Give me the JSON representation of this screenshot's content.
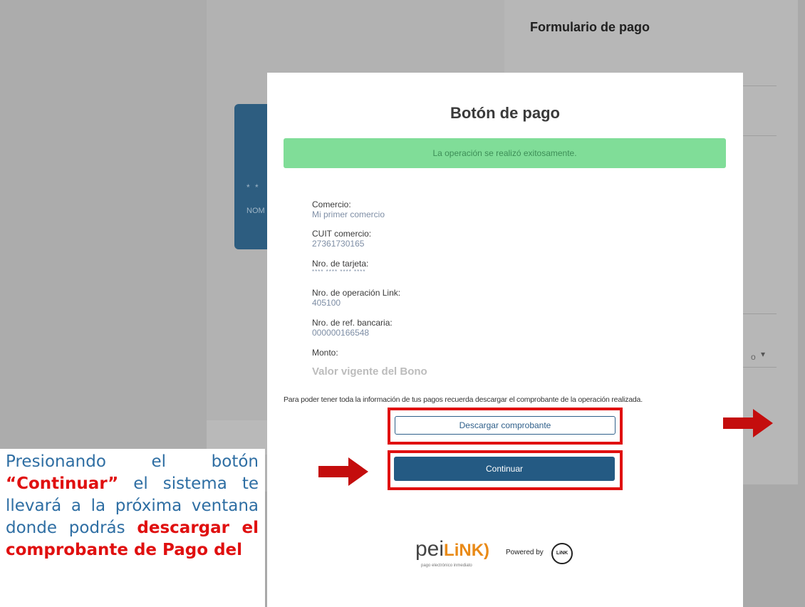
{
  "background": {
    "form_title": "Formulario de pago",
    "card_masked": "* *",
    "card_name_fragment": "NOM",
    "dropdown_fragment": "o"
  },
  "modal": {
    "title": "Botón de pago",
    "success_message": "La operación se realizó exitosamente.",
    "fields": [
      {
        "label": "Comercio:",
        "value": "Mi primer comercio"
      },
      {
        "label": "CUIT comercio:",
        "value": "27361730165"
      },
      {
        "label": "Nro. de tarjeta:",
        "value": "**** **** **** ****"
      },
      {
        "label": "Nro. de operación Link:",
        "value": "405100"
      },
      {
        "label": "Nro. de ref. bancaria:",
        "value": "000000166548"
      },
      {
        "label": "Monto:",
        "value": "Valor vigente del Bono"
      }
    ],
    "note": "Para poder tener toda la información de tus pagos recuerda descargar el comprobante de la operación realizada.",
    "download_button": "Descargar comprobante",
    "continue_button": "Continuar",
    "logo_pei": "pei",
    "logo_link": "LiNK)",
    "logo_sub": "pago electrónico inmediato",
    "powered_by": "Powered by",
    "link_badge": "LiNK"
  },
  "instruction": {
    "part1": "Presionando el botón ",
    "part2": "“Continuar”",
    "part3": " el sistema te llevará a la próxima ventana donde podrás ",
    "part4": "descargar el comprobante de Pago del"
  },
  "colors": {
    "highlight": "#e01010",
    "arrow": "#c40d0d",
    "primary_button": "#245a83",
    "success_bg": "#80dd98",
    "instruction_text": "#2e6ea3"
  },
  "icons": [
    "arrow-right-icon",
    "chevron-down-icon"
  ]
}
